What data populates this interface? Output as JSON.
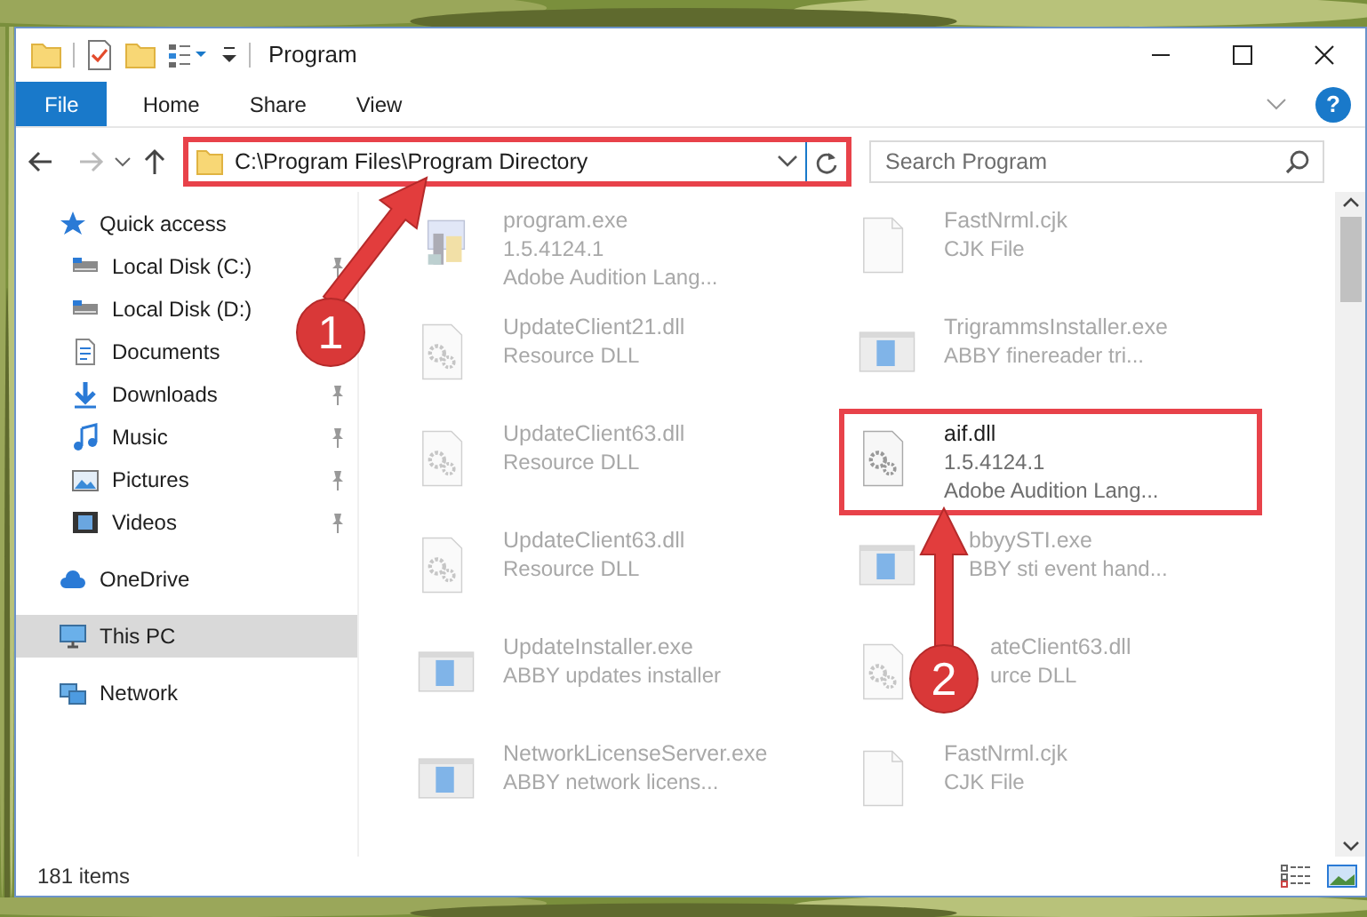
{
  "window": {
    "title": "Program"
  },
  "ribbon": {
    "tabs": [
      {
        "label": "File",
        "selected": true
      },
      {
        "label": "Home",
        "selected": false
      },
      {
        "label": "Share",
        "selected": false
      },
      {
        "label": "View",
        "selected": false
      }
    ],
    "help": "?"
  },
  "address": {
    "path": "C:\\Program Files\\Program Directory",
    "highlighted": true
  },
  "search": {
    "placeholder": "Search Program"
  },
  "sidebar": {
    "items": [
      {
        "label": "Quick access",
        "kind": "star",
        "selected": false,
        "children": [
          {
            "label": "Local Disk (C:)",
            "kind": "drive",
            "pinned": true,
            "selected": false
          },
          {
            "label": "Local Disk (D:)",
            "kind": "drive",
            "selected": false
          },
          {
            "label": "Documents",
            "kind": "documents",
            "selected": false
          },
          {
            "label": "Downloads",
            "kind": "downloads",
            "pinned": true,
            "selected": false
          },
          {
            "label": "Music",
            "kind": "music",
            "pinned": true,
            "selected": false
          },
          {
            "label": "Pictures",
            "kind": "pictures",
            "pinned": true,
            "selected": false
          },
          {
            "label": "Videos",
            "kind": "videos",
            "pinned": true,
            "selected": false
          }
        ]
      },
      {
        "label": "OneDrive",
        "kind": "cloud",
        "selected": false
      },
      {
        "label": "This PC",
        "kind": "pc",
        "selected": true
      },
      {
        "label": "Network",
        "kind": "network",
        "selected": false
      }
    ]
  },
  "files": [
    {
      "name": "program.exe",
      "details": [
        "1.5.4124.1",
        "Adobe Audition Lang..."
      ],
      "kind": "program",
      "dimmed": true,
      "highlighted": false
    },
    {
      "name": "FastNrml.cjk",
      "details": [
        "CJK File"
      ],
      "kind": "blank",
      "dimmed": true,
      "highlighted": false
    },
    {
      "name": "UpdateClient21.dll",
      "details": [
        "Resource DLL"
      ],
      "kind": "dll",
      "dimmed": true,
      "highlighted": false
    },
    {
      "name": "TrigrammsInstaller.exe",
      "details": [
        "ABBY finereader tri..."
      ],
      "kind": "installer",
      "dimmed": true,
      "highlighted": false
    },
    {
      "name": "UpdateClient63.dll",
      "details": [
        "Resource DLL"
      ],
      "kind": "dll",
      "dimmed": true,
      "highlighted": false
    },
    {
      "name": "aif.dll",
      "details": [
        "1.5.4124.1",
        "Adobe Audition Lang..."
      ],
      "kind": "dll",
      "dimmed": false,
      "highlighted": true
    },
    {
      "name": "UpdateClient63.dll",
      "details": [
        "Resource DLL"
      ],
      "kind": "dll",
      "dimmed": true,
      "highlighted": false
    },
    {
      "name": "bbyySTI.exe",
      "details": [
        "BBY sti event hand..."
      ],
      "kind": "installer",
      "dimmed": true,
      "highlighted": false,
      "under_arrow": true
    },
    {
      "name": "UpdateInstaller.exe",
      "details": [
        "ABBY updates installer"
      ],
      "kind": "installer",
      "dimmed": true,
      "highlighted": false
    },
    {
      "name": "ateClient63.dll",
      "details": [
        "urce DLL"
      ],
      "kind": "dll",
      "dimmed": true,
      "highlighted": false,
      "under_badge": true
    },
    {
      "name": "NetworkLicenseServer.exe",
      "details": [
        "ABBY network licens..."
      ],
      "kind": "installer",
      "dimmed": true,
      "highlighted": false
    },
    {
      "name": "FastNrml.cjk",
      "details": [
        "CJK File"
      ],
      "kind": "blank",
      "dimmed": true,
      "highlighted": false
    }
  ],
  "status_bar": {
    "count": "181 items"
  },
  "annotations": [
    {
      "label": "1"
    },
    {
      "label": "2"
    }
  ]
}
